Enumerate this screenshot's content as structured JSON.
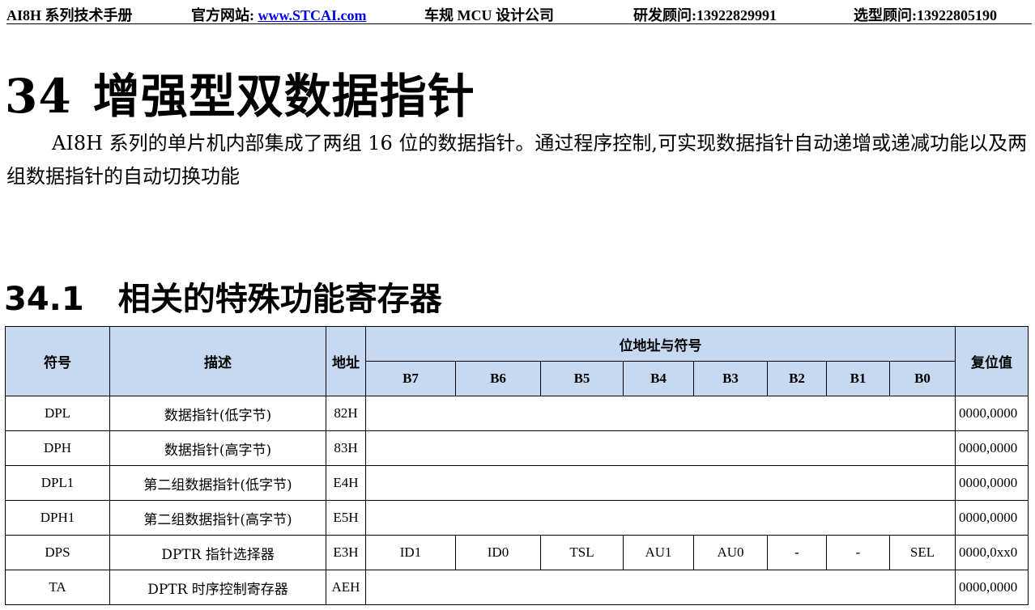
{
  "header": {
    "manual": "AI8H 系列技术手册",
    "website_label": "官方网站:",
    "website_link": "www.STCAI.com",
    "company": "车规 MCU 设计公司",
    "rd_contact": "研发顾问:13922829991",
    "sales_contact": "选型顾问:13922805190"
  },
  "chapter": {
    "number": "34",
    "title": "增强型双数据指针"
  },
  "intro": "AI8H 系列的单片机内部集成了两组 16 位的数据指针。通过程序控制,可实现数据指针自动递增或递减功能以及两组数据指针的自动切换功能",
  "section": {
    "number": "34.1",
    "title": "相关的特殊功能寄存器"
  },
  "table": {
    "headers": {
      "symbol": "符号",
      "description": "描述",
      "address": "地址",
      "bits_group": "位地址与符号",
      "bits": [
        "B7",
        "B6",
        "B5",
        "B4",
        "B3",
        "B2",
        "B1",
        "B0"
      ],
      "reset": "复位值"
    },
    "rows": [
      {
        "symbol": "DPL",
        "description": "数据指针(低字节)",
        "address": "82H",
        "reset": "0000,0000"
      },
      {
        "symbol": "DPH",
        "description": "数据指针(高字节)",
        "address": "83H",
        "reset": "0000,0000"
      },
      {
        "symbol": "DPL1",
        "description": "第二组数据指针(低字节)",
        "address": "E4H",
        "reset": "0000,0000"
      },
      {
        "symbol": "DPH1",
        "description": "第二组数据指针(高字节)",
        "address": "E5H",
        "reset": "0000,0000"
      },
      {
        "symbol": "DPS",
        "description": "DPTR 指针选择器",
        "address": "E3H",
        "bits": [
          "ID1",
          "ID0",
          "TSL",
          "AU1",
          "AU0",
          "-",
          "-",
          "SEL"
        ],
        "reset": "0000,0xx0"
      },
      {
        "symbol": "TA",
        "description": "DPTR 时序控制寄存器",
        "address": "AEH",
        "reset": "0000,0000"
      }
    ]
  }
}
